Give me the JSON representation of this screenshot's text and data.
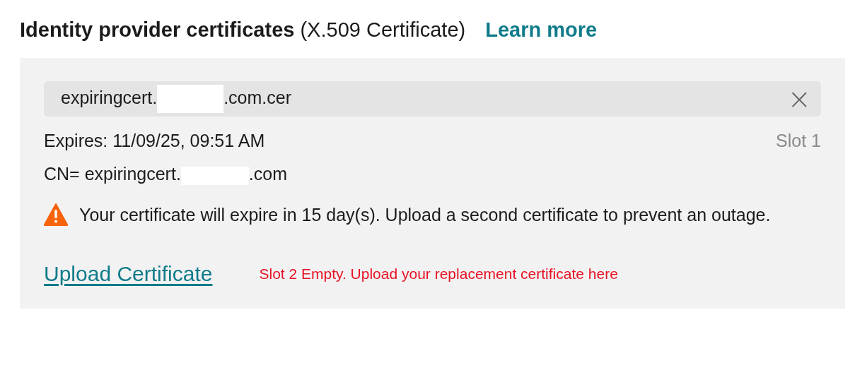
{
  "heading": {
    "title": "Identity provider certificates",
    "qualifier": "(X.509 Certificate)",
    "link": "Learn more"
  },
  "certificate": {
    "file_name_parts": [
      "expiringcert.",
      ".com.cer"
    ],
    "remove_button": "×",
    "expires": "Expires: 11/09/25, 09:51 AM",
    "slot": "Slot 1",
    "cn_parts": [
      "CN= expiringcert.",
      ".com"
    ],
    "warning": {
      "kind": "warning",
      "text": "Your certificate will expire in 15 day(s). Upload a second certificate to prevent an outage."
    }
  },
  "upload": {
    "link": "Upload Certificate",
    "note": "Slot 2 Empty. Upload your replacement certificate here"
  }
}
